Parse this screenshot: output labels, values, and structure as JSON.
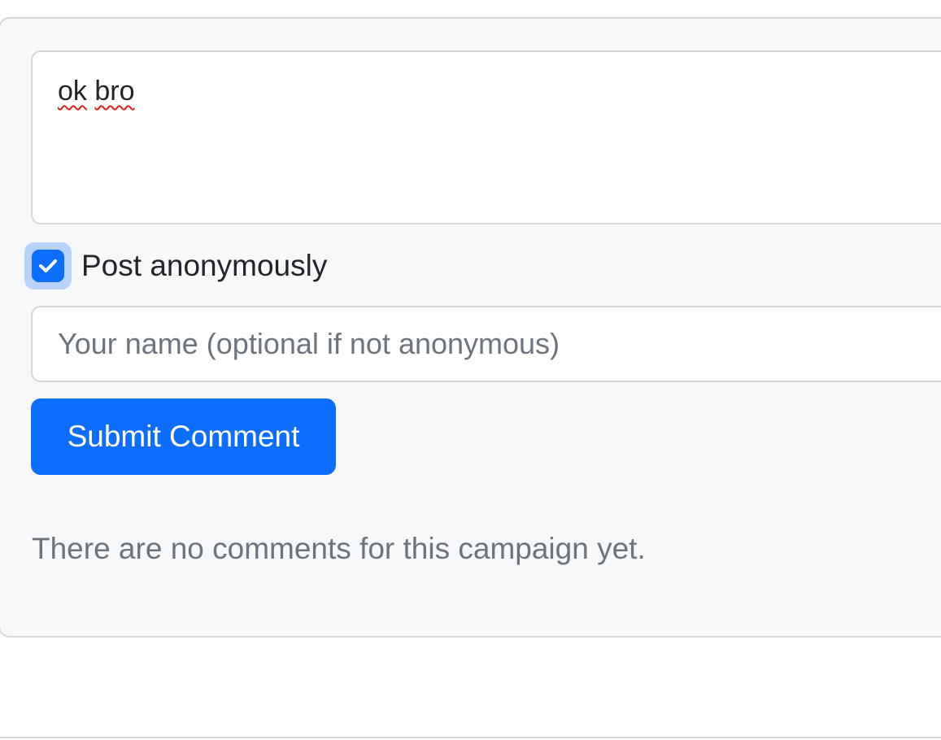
{
  "comment_form": {
    "comment_value": "ok bro",
    "comment_words": [
      "ok",
      "bro"
    ],
    "anonymous_checked": true,
    "anonymous_label": "Post anonymously",
    "name_placeholder": "Your name (optional if not anonymous)",
    "submit_label": "Submit Comment"
  },
  "comments": {
    "empty_message": "There are no comments for this campaign yet."
  },
  "icons": {
    "checkbox": "check-icon"
  },
  "colors": {
    "accent": "#0d6efd",
    "card_bg": "#f7f8fa",
    "border": "#d5d8dc",
    "muted_text": "#6c757d",
    "text": "#212529",
    "focus_ring": "#b8d3fb",
    "spellcheck": "#e02020"
  }
}
